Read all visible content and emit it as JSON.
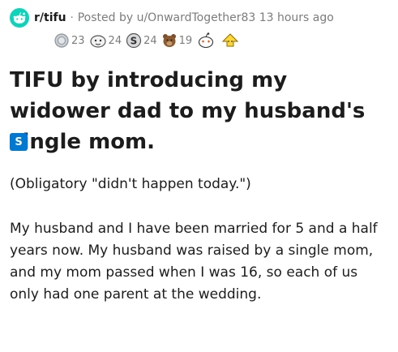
{
  "header": {
    "subreddit": "r/tifu",
    "separator": "·",
    "posted_by": "Posted by u/OnwardTogether83 13 hours ago"
  },
  "awards": [
    {
      "icon": "silver-award-icon",
      "count": "23"
    },
    {
      "icon": "helpful-award-icon",
      "count": "24"
    },
    {
      "icon": "wholesome-award-icon",
      "count": "24"
    },
    {
      "icon": "bear-award-icon",
      "count": "19"
    },
    {
      "icon": "heart-eyes-award-icon",
      "count": ""
    },
    {
      "icon": "up-arrow-award-icon",
      "count": ""
    }
  ],
  "post": {
    "title": "TIFU by introducing my widower dad to my husband's single mom.",
    "flair": "S",
    "paragraph_1": "(Obligatory \"didn't happen today.\")",
    "paragraph_2": "My husband and I have been married for 5 and a half years now. My husband was raised by a single mom, and my mom passed when I was 16, so each of us only had one parent at the wedding."
  },
  "colors": {
    "accent": "#0079d3",
    "text": "#1c1c1c",
    "meta": "#7c7c7c"
  }
}
